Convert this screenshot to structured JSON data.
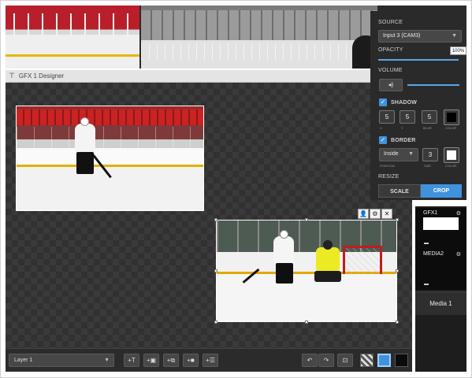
{
  "designer": {
    "title": "GFX 1 Designer"
  },
  "panel": {
    "source_label": "SOURCE",
    "source_value": "Input 3 (CAM3)",
    "opacity_label": "OPACITY",
    "opacity_value": "100%",
    "volume_label": "VOLUME",
    "shadow": {
      "label": "SHADOW",
      "checked": true,
      "values": [
        "5",
        "5",
        "5"
      ],
      "sublabels": [
        "X",
        "Y",
        "BLUR",
        "COLOR"
      ],
      "color": "#000000"
    },
    "border": {
      "label": "BORDER",
      "checked": true,
      "position_value": "Inside",
      "size_value": "3",
      "sublabels": [
        "POSITION",
        "SIZE",
        "COLOR"
      ],
      "color": "#ffffff"
    },
    "resize": {
      "label": "RESIZE",
      "scale_label": "SCALE",
      "crop_label": "CROP",
      "active": "CROP"
    }
  },
  "toolbar": {
    "layer_select": "Layer 1",
    "buttons": [
      "add-text",
      "add-image",
      "add-slideshow",
      "add-video",
      "add-list"
    ],
    "undo_icon": "undo-icon",
    "redo_icon": "redo-icon",
    "fit_icon": "fit-to-screen-icon",
    "view_modes": [
      "checker",
      "blue",
      "black"
    ],
    "active_view": "blue"
  },
  "sources": {
    "gfx1_label": "GFX1",
    "media2_label": "MEDIA2",
    "media1_label": "Media 1"
  },
  "colors": {
    "accent": "#3f93dd",
    "panel_bg": "#2a2a2a",
    "canvas_bg": "#313131"
  }
}
